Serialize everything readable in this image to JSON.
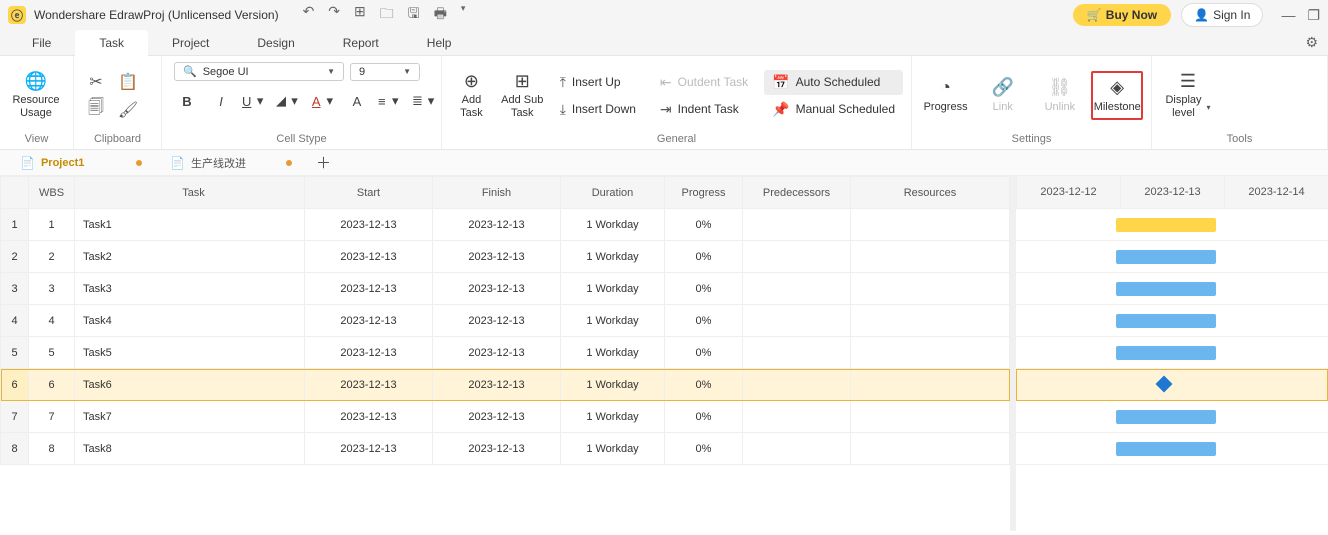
{
  "titlebar": {
    "app_title": "Wondershare EdrawProj (Unlicensed Version)",
    "buy_label": "Buy Now",
    "signin_label": "Sign In"
  },
  "menu": {
    "items": [
      "File",
      "Task",
      "Project",
      "Design",
      "Report",
      "Help"
    ],
    "active_index": 1
  },
  "ribbon": {
    "view": {
      "label": "View",
      "resource_usage": "Resource\nUsage"
    },
    "clipboard": {
      "label": "Clipboard"
    },
    "cell": {
      "label": "Cell Stype",
      "font_name": "Segoe UI",
      "font_size": "9"
    },
    "general": {
      "label": "General",
      "add_task": "Add\nTask",
      "add_sub_task": "Add Sub\nTask",
      "insert_up": "Insert Up",
      "insert_down": "Insert Down",
      "outdent": "Outdent Task",
      "indent": "Indent Task",
      "auto": "Auto Scheduled",
      "manual": "Manual Scheduled"
    },
    "settings": {
      "label": "Settings",
      "progress": "Progress",
      "link": "Link",
      "unlink": "Unlink",
      "milestone": "Milestone"
    },
    "tools": {
      "label": "Tools",
      "display": "Display\nlevel"
    }
  },
  "doctabs": {
    "tabs": [
      {
        "name": "Project1",
        "active": true
      },
      {
        "name": "生产线改进",
        "active": false
      }
    ]
  },
  "grid": {
    "headers": {
      "wbs": "WBS",
      "task": "Task",
      "start": "Start",
      "finish": "Finish",
      "duration": "Duration",
      "progress": "Progress",
      "pred": "Predecessors",
      "res": "Resources"
    },
    "rows": [
      {
        "n": "1",
        "wbs": "1",
        "task": "Task1",
        "start": "2023-12-13",
        "finish": "2023-12-13",
        "dur": "1 Workday",
        "prog": "0%",
        "bar": "yellow"
      },
      {
        "n": "2",
        "wbs": "2",
        "task": "Task2",
        "start": "2023-12-13",
        "finish": "2023-12-13",
        "dur": "1 Workday",
        "prog": "0%",
        "bar": "blue"
      },
      {
        "n": "3",
        "wbs": "3",
        "task": "Task3",
        "start": "2023-12-13",
        "finish": "2023-12-13",
        "dur": "1 Workday",
        "prog": "0%",
        "bar": "blue"
      },
      {
        "n": "4",
        "wbs": "4",
        "task": "Task4",
        "start": "2023-12-13",
        "finish": "2023-12-13",
        "dur": "1 Workday",
        "prog": "0%",
        "bar": "blue"
      },
      {
        "n": "5",
        "wbs": "5",
        "task": "Task5",
        "start": "2023-12-13",
        "finish": "2023-12-13",
        "dur": "1 Workday",
        "prog": "0%",
        "bar": "blue"
      },
      {
        "n": "6",
        "wbs": "6",
        "task": "Task6",
        "start": "2023-12-13",
        "finish": "2023-12-13",
        "dur": "1 Workday",
        "prog": "0%",
        "bar": "milestone",
        "selected": true
      },
      {
        "n": "7",
        "wbs": "7",
        "task": "Task7",
        "start": "2023-12-13",
        "finish": "2023-12-13",
        "dur": "1 Workday",
        "prog": "0%",
        "bar": "blue"
      },
      {
        "n": "8",
        "wbs": "8",
        "task": "Task8",
        "start": "2023-12-13",
        "finish": "2023-12-13",
        "dur": "1 Workday",
        "prog": "0%",
        "bar": "blue"
      }
    ]
  },
  "gantt": {
    "dates": [
      "2023-12-12",
      "2023-12-13",
      "2023-12-14"
    ]
  }
}
